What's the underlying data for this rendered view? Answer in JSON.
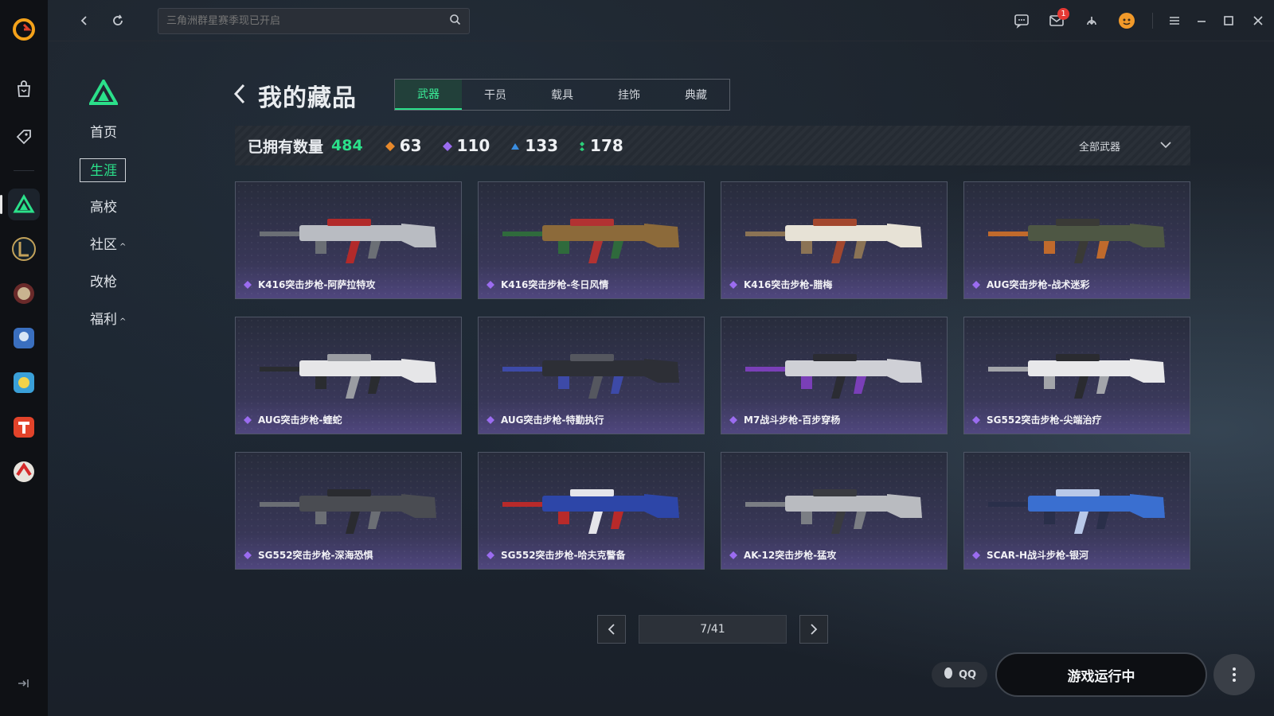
{
  "search": {
    "placeholder": "三角洲群星赛季现已开启"
  },
  "subnav": {
    "items": [
      {
        "label": "首页",
        "caret": ""
      },
      {
        "label": "生涯",
        "caret": ""
      },
      {
        "label": "高校",
        "caret": ""
      },
      {
        "label": "社区",
        "caret": "^"
      },
      {
        "label": "改枪",
        "caret": ""
      },
      {
        "label": "福利",
        "caret": "^"
      }
    ]
  },
  "header": {
    "title": "我的藏品"
  },
  "tabs": [
    "武器",
    "干员",
    "载具",
    "挂饰",
    "典藏"
  ],
  "stats": {
    "owned_label": "已拥有数量",
    "owned_count": "484",
    "gold": "63",
    "purple": "110",
    "blue": "133",
    "green": "178",
    "filter_label": "全部武器"
  },
  "items": [
    {
      "name": "K416突击步枪-阿萨拉特攻",
      "palette": [
        "#b9bcc2",
        "#b22a2a",
        "#6b6f75"
      ]
    },
    {
      "name": "K416突击步枪-冬日风情",
      "palette": [
        "#8c6a3a",
        "#b23232",
        "#2f6a3c"
      ]
    },
    {
      "name": "K416突击步枪-腊梅",
      "palette": [
        "#e7e2d6",
        "#a3472e",
        "#8b7355"
      ]
    },
    {
      "name": "AUG突击步枪-战术迷彩",
      "palette": [
        "#4e5744",
        "#3a3a36",
        "#c06a2c"
      ]
    },
    {
      "name": "AUG突击步枪-蝰蛇",
      "palette": [
        "#e6e6e8",
        "#9a9ca2",
        "#2a2c30"
      ]
    },
    {
      "name": "AUG突击步枪-特勤执行",
      "palette": [
        "#2d2f36",
        "#55575f",
        "#3d4aa8"
      ]
    },
    {
      "name": "M7战斗步枪-百步穿杨",
      "palette": [
        "#cfd0d6",
        "#2b2c33",
        "#7a3fb8"
      ]
    },
    {
      "name": "SG552突击步枪-尖端治疗",
      "palette": [
        "#e8e8ea",
        "#2a2b30",
        "#a3a5aa"
      ]
    },
    {
      "name": "SG552突击步枪-深海恐惧",
      "palette": [
        "#4a4c52",
        "#2a2b30",
        "#6b6e74"
      ]
    },
    {
      "name": "SG552突击步枪-哈夫克警备",
      "palette": [
        "#2d46a8",
        "#e5e5ea",
        "#b82a2a"
      ]
    },
    {
      "name": "AK-12突击步枪-猛攻",
      "palette": [
        "#b9bbc0",
        "#3a3b40",
        "#7b7e84"
      ]
    },
    {
      "name": "SCAR-H战斗步枪-银河",
      "palette": [
        "#3a6fd0",
        "#b8c8e8",
        "#2a2f4a"
      ]
    }
  ],
  "pager": {
    "current": "7/41"
  },
  "bottom": {
    "qq_label": "QQ",
    "launch_label": "游戏运行中"
  },
  "mail_badge": "1",
  "colors": {
    "accent": "#2be08a"
  }
}
